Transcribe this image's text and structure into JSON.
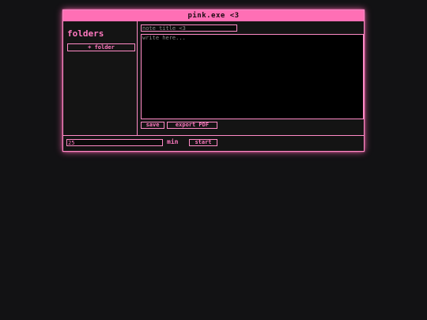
{
  "window": {
    "title": "pink.exe <3"
  },
  "sidebar": {
    "heading": "folders",
    "add_folder_label": "+ folder"
  },
  "editor": {
    "title_placeholder": "note title <3",
    "body_placeholder": "write here...",
    "save_label": "save",
    "export_label": "export PDF"
  },
  "timer": {
    "minutes_value": "25",
    "unit_label": "min",
    "start_label": "start"
  },
  "colors": {
    "accent": "#ff6fb5",
    "border": "#ff8ac6",
    "text_pink": "#ff79c0",
    "background": "#121214",
    "panel": "#141414",
    "editor_bg": "#000000",
    "placeholder": "#8a8a8a"
  }
}
